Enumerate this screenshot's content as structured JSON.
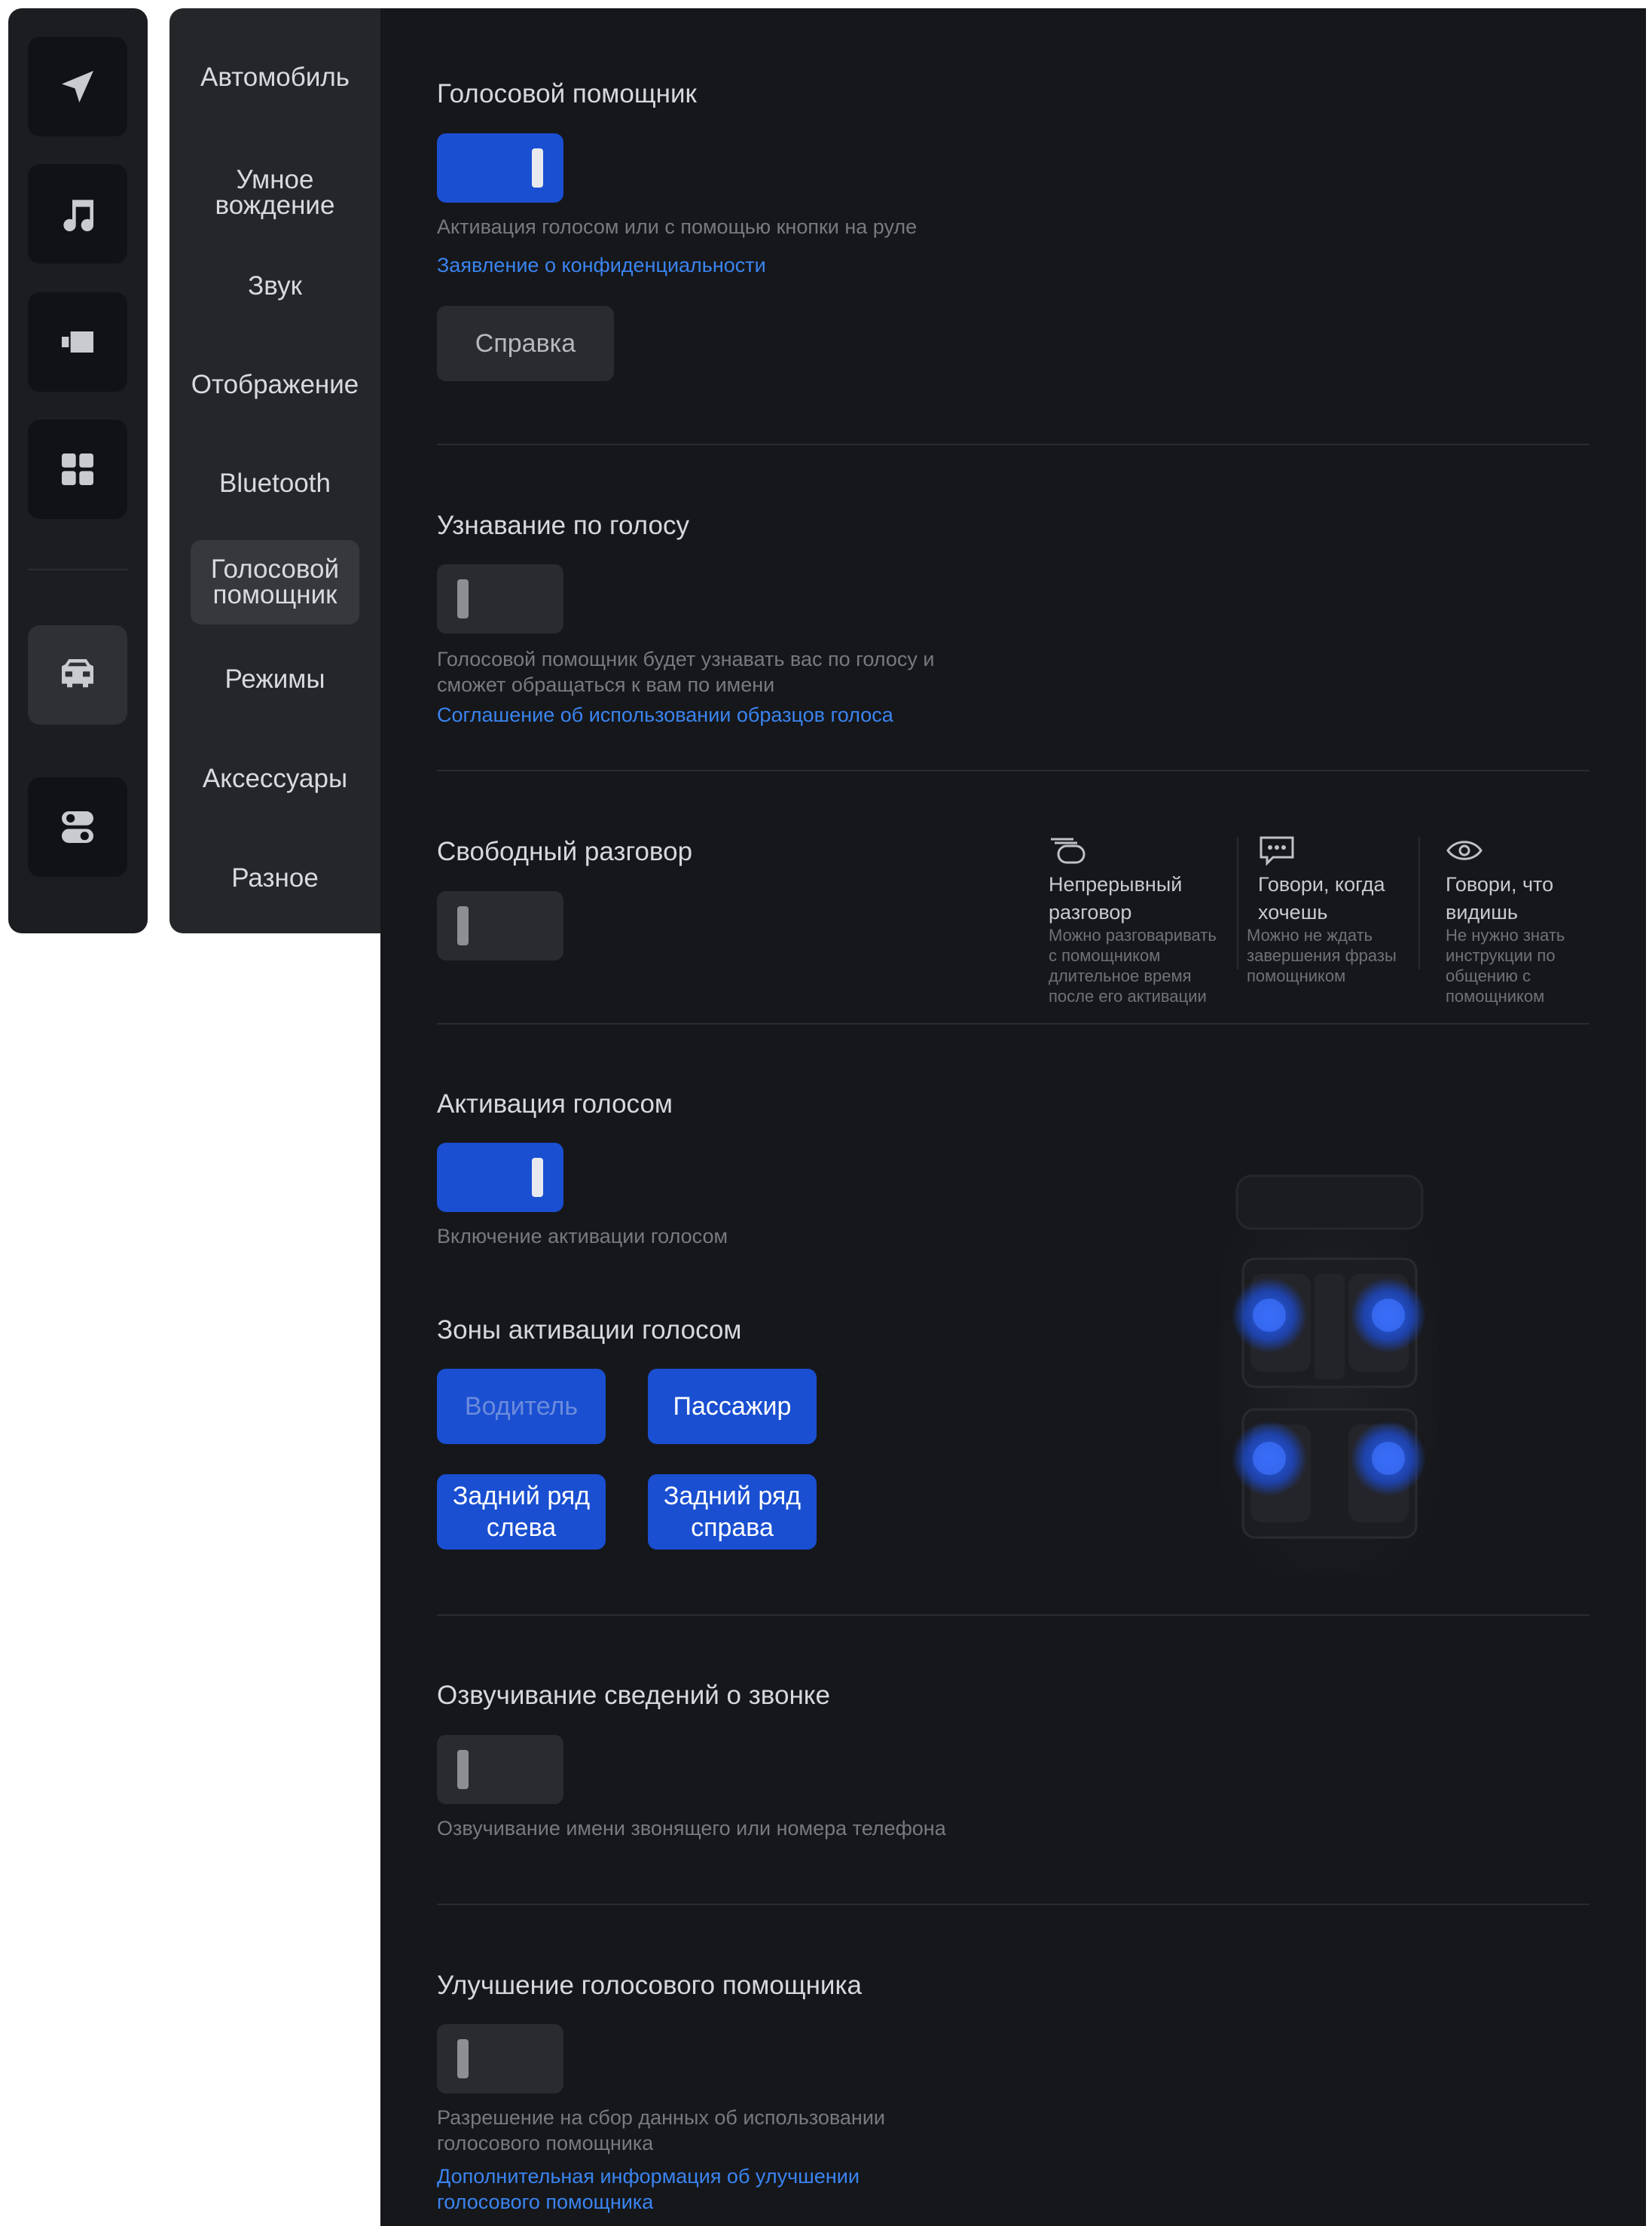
{
  "rail": {
    "items": [
      {
        "name": "navigation-icon"
      },
      {
        "name": "music-icon"
      },
      {
        "name": "video-icon"
      },
      {
        "name": "apps-icon"
      },
      {
        "name": "car-icon"
      },
      {
        "name": "settings-toggle-icon"
      }
    ],
    "active_item": "car-icon"
  },
  "menu": {
    "items": [
      {
        "label": "Автомобиль"
      },
      {
        "label": "Умное вождение"
      },
      {
        "label": "Звук"
      },
      {
        "label": "Отображение"
      },
      {
        "label": "Bluetooth"
      },
      {
        "label": "Голосовой помощник"
      },
      {
        "label": "Режимы"
      },
      {
        "label": "Аксессуары"
      },
      {
        "label": "Разное"
      }
    ],
    "active_label": "Голосовой помощник"
  },
  "main": {
    "voice_assistant": {
      "title": "Голосовой помощник",
      "enabled": true,
      "description": "Активация голосом или с помощью кнопки на руле",
      "link": "Заявление о конфиденциальности",
      "help_button": "Справка"
    },
    "voice_recognition": {
      "title": "Узнавание по голосу",
      "enabled": false,
      "description_line1": "Голосовой помощник будет узнавать вас по голосу и",
      "description_line2": "сможет обращаться к вам по имени",
      "link": "Соглашение об использовании образцов голоса"
    },
    "free_talk": {
      "title": "Свободный разговор",
      "enabled": false,
      "features": [
        {
          "icon": "chat-layers-icon",
          "title_line1": "Непрерывный",
          "title_line2": "разговор",
          "desc_lines": [
            "Можно разговаривать",
            "с помощником",
            "длительное время",
            "после его активации"
          ]
        },
        {
          "icon": "message-dots-icon",
          "title_line1": "Говори, когда",
          "title_line2": "хочешь",
          "desc_lines": [
            "Можно не ждать",
            "завершения фразы",
            "помощником"
          ]
        },
        {
          "icon": "eye-icon",
          "title_line1": "Говори, что",
          "title_line2": "видишь",
          "desc_lines": [
            "Не нужно знать",
            "инструкции по",
            "общению с",
            "помощником"
          ]
        }
      ]
    },
    "voice_activation": {
      "title": "Активация голосом",
      "enabled": true,
      "description": "Включение активации голосом",
      "zones_title": "Зоны активации голосом",
      "zones": {
        "driver": "Водитель",
        "passenger": "Пассажир",
        "rear_left_l1": "Задний ряд",
        "rear_left_l2": "слева",
        "rear_right_l1": "Задний ряд",
        "rear_right_l2": "справа"
      }
    },
    "call_announce": {
      "title": "Озвучивание сведений о звонке",
      "enabled": false,
      "description": "Озвучивание имени звонящего или номера телефона"
    },
    "improve": {
      "title": "Улучшение голосового помощника",
      "enabled": false,
      "description_line1": "Разрешение на сбор данных об использовании",
      "description_line2": "голосового помощника",
      "link_line1": "Дополнительная информация об улучшении",
      "link_line2": "голосового помощника"
    }
  },
  "colors": {
    "accent": "#1a4fd1",
    "link": "#3a84f0",
    "background": "#16171b"
  }
}
